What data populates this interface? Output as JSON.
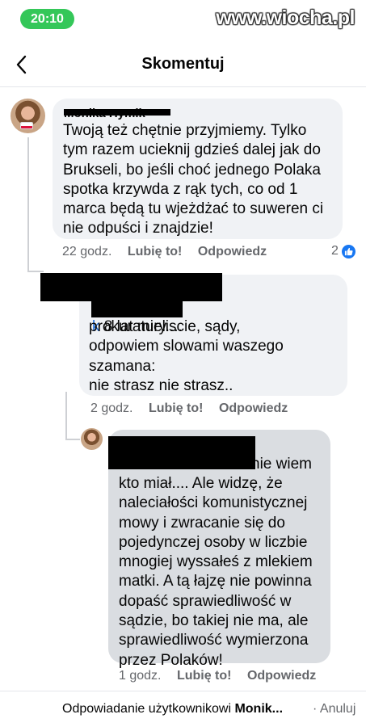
{
  "status": {
    "time": "20:10"
  },
  "watermark": "www.wiocha.pl",
  "header": {
    "title": "Skomentuj"
  },
  "comments": [
    {
      "author": "Monika Hymik",
      "text": "Twoją też chętnie przyjmiemy. Tylko\ntym razem ucieknij gdzieś dalej jak do\nBrukseli, bo jeśli choć jednego Polaka\nspotka krzywda z rąk tych, co od 1\nmarca będą tu wjeżdżać to suweren ci\nnie odpuści i znajdzie!",
      "time": "22 godz.",
      "like": "Lubię to!",
      "reply": "Odpowiedz",
      "reactions": "2"
    },
    {
      "mention_tail": "k",
      "text_first": " 8 lat mieliscie, sądy,",
      "text_rest": "prokuratury....\nodpowiem slowami waszego\nszamana:\nnie strasz nie strasz..",
      "time": "2 godz.",
      "like": "Lubię to!",
      "reply": "Odpowiedz"
    },
    {
      "text_first": "nie wiem",
      "text_rest": "kto miał.... Ale widzę, że\nnaleciałości komunistycznej\nmowy i zwracanie się do\npojedynczej osoby w liczbie\nmnogiej wyssałeś z mlekiem\nmatki. A tą łajzę nie powinna\ndopaść sprawiedliwość w\nsądzie, bo takiej nie ma, ale\nsprawiedliwość wymierzona\nprzez Polaków!",
      "time": "1 godz.",
      "like": "Lubię to!",
      "reply": "Odpowiedz"
    }
  ],
  "reply_bar": {
    "prefix": "Odpowiadanie użytkownikowi ",
    "name": "Monik...",
    "separator": " · ",
    "cancel": "Anuluj"
  },
  "colors": {
    "accent": "#1877f2",
    "status_pill": "#34c759",
    "bubble": "#f0f2f5",
    "bubble_dark": "#dadde1"
  }
}
